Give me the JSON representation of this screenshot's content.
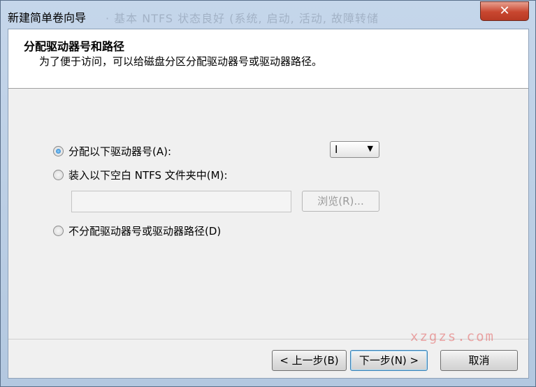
{
  "window": {
    "title": "新建简单卷向导",
    "background_text": "· 基本 NTFS    状态良好 (系统, 启动, 活动, 故障转储",
    "close_symbol": "✕"
  },
  "header": {
    "title": "分配驱动器号和路径",
    "subtitle": "为了便于访问，可以给磁盘分区分配驱动器号或驱动器路径。"
  },
  "options": {
    "assign_letter": {
      "label": "分配以下驱动器号(A):",
      "checked": true
    },
    "mount_folder": {
      "label": "装入以下空白 NTFS 文件夹中(M):",
      "checked": false
    },
    "no_assign": {
      "label": "不分配驱动器号或驱动器路径(D)",
      "checked": false
    }
  },
  "drive_letter": {
    "value": "I",
    "arrow": "▼"
  },
  "mount_path": {
    "value": ""
  },
  "browse_button": {
    "label": "浏览(R)..."
  },
  "footer": {
    "back_label": "< 上一步(B)",
    "next_label": "下一步(N) >",
    "cancel_label": "取消"
  },
  "watermark": "xzgzs.com"
}
